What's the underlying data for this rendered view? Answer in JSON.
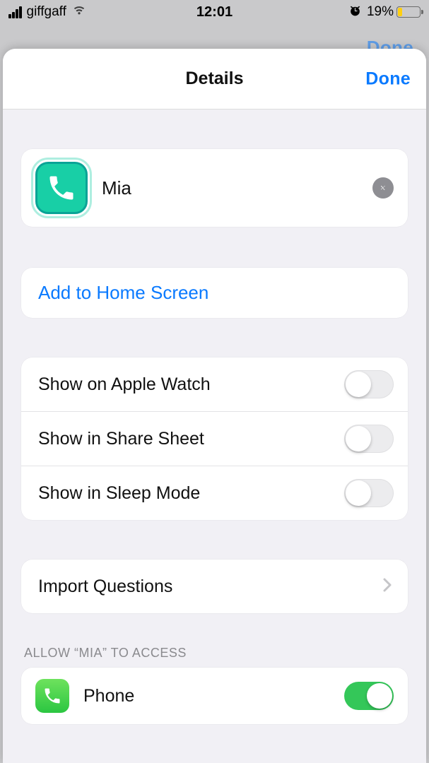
{
  "status_bar": {
    "carrier": "giffgaff",
    "time": "12:01",
    "battery_pct": "19%"
  },
  "ghost_done": "Done",
  "sheet": {
    "title": "Details",
    "done": "Done"
  },
  "shortcut": {
    "name": "Mia"
  },
  "actions": {
    "add_home": "Add to Home Screen",
    "import_questions": "Import Questions"
  },
  "toggles": {
    "apple_watch": {
      "label": "Show on Apple Watch",
      "on": false
    },
    "share_sheet": {
      "label": "Show in Share Sheet",
      "on": false
    },
    "sleep_mode": {
      "label": "Show in Sleep Mode",
      "on": false
    }
  },
  "access": {
    "section_title": "ALLOW “MIA” TO ACCESS",
    "phone": {
      "label": "Phone",
      "on": true
    }
  }
}
